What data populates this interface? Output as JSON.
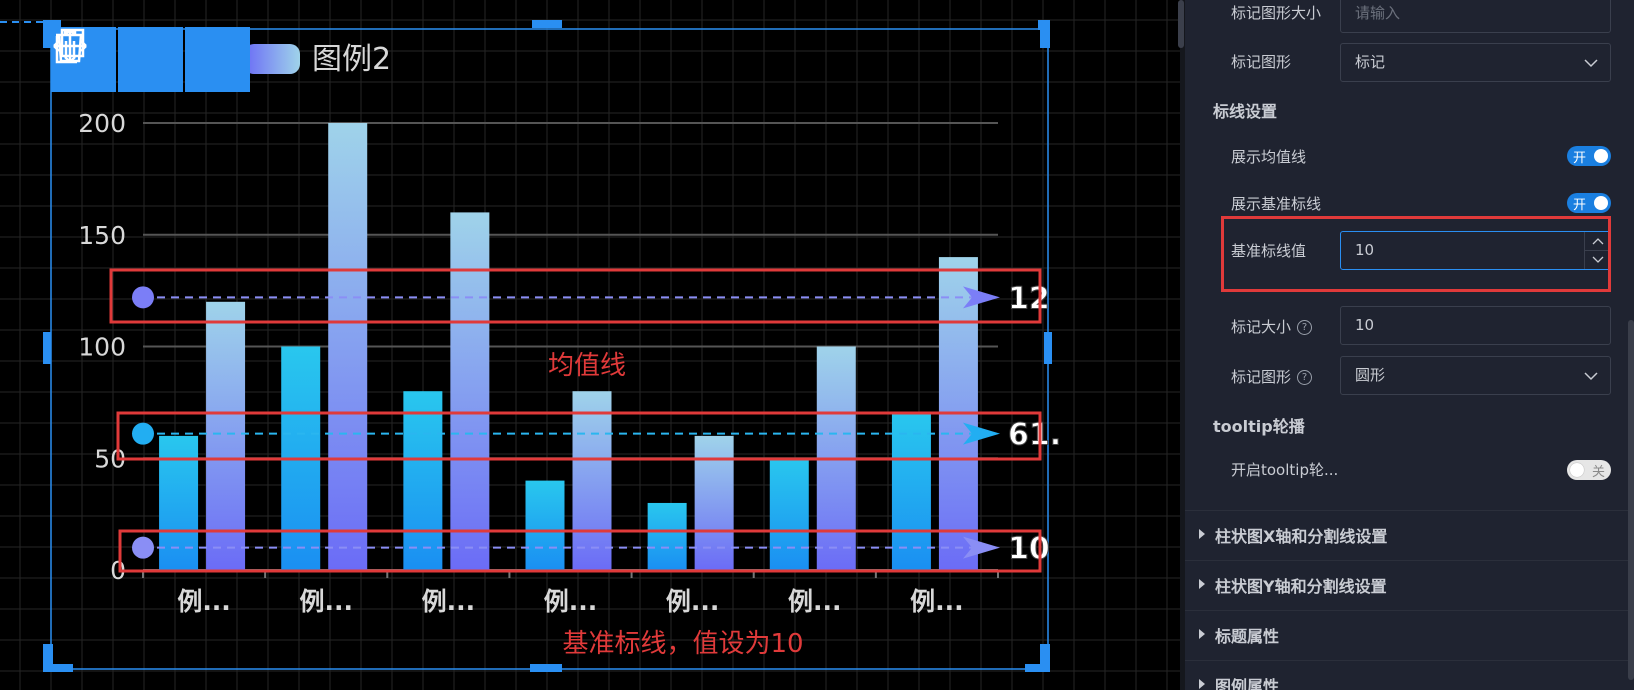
{
  "chart_data": {
    "type": "bar",
    "categories": [
      "例...",
      "例...",
      "例...",
      "例...",
      "例...",
      "例...",
      "例..."
    ],
    "series": [
      {
        "name": "",
        "values": [
          60,
          100,
          80,
          40,
          30,
          50,
          70
        ]
      },
      {
        "name": "图例2",
        "values": [
          120,
          200,
          160,
          80,
          60,
          100,
          140
        ]
      }
    ],
    "ylim": [
      0,
      200
    ],
    "yticks": [
      "0",
      "50",
      "100",
      "150",
      "200"
    ],
    "legend": "top-left",
    "grid": true,
    "marklines": [
      {
        "label": "12",
        "value": 122
      },
      {
        "label": "61.",
        "value": 61
      },
      {
        "label": "10",
        "value": 10
      }
    ],
    "annotations": [
      "均值线",
      "基准标线，值设为10"
    ],
    "colors": {
      "series1_top": "#29c7ee",
      "series1_bottom": "#1a8ff2",
      "series2_top": "#9fd3ea",
      "series2_bottom": "#6b6cf6",
      "annotation_red": "#e03a3a"
    }
  },
  "toolbar": {
    "icons": [
      "move-icon",
      "copy-icon",
      "delete-icon"
    ]
  },
  "panel": {
    "marker_size_label": "标记图形大小",
    "marker_size_placeholder": "请输入",
    "marker_shape_label": "标记图形",
    "marker_shape_value": "标记",
    "markline_section": "标线设置",
    "show_avg_label": "展示均值线",
    "show_avg_toggle": "开",
    "show_base_label": "展示基准标线",
    "show_base_toggle": "开",
    "base_value_label": "基准标线值",
    "base_value": "10",
    "mark_size_label": "标记大小",
    "mark_size_value": "10",
    "mark_shape_label": "标记图形",
    "mark_shape_value": "圆形",
    "tooltip_section": "tooltip轮播",
    "tooltip_enable_label": "开启tooltip轮...",
    "tooltip_toggle": "关",
    "collapsed": [
      "柱状图X轴和分割线设置",
      "柱状图Y轴和分割线设置",
      "标题属性",
      "图例属性"
    ]
  }
}
